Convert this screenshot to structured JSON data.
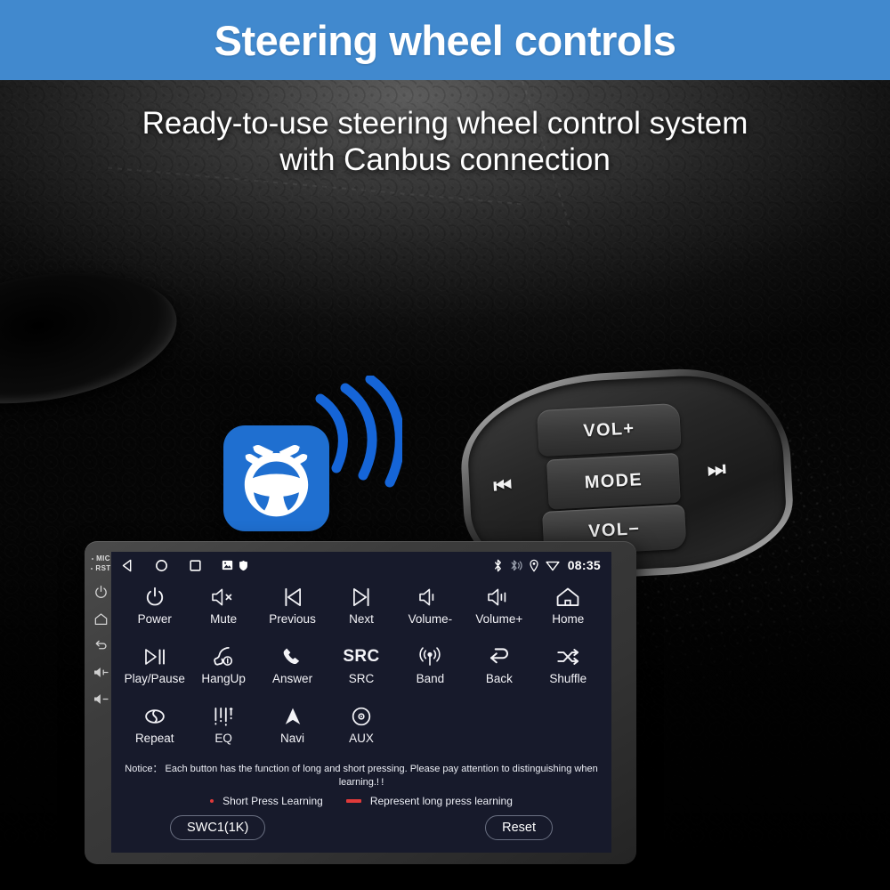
{
  "header": {
    "title": "Steering wheel controls",
    "bg_color": "#4189ce"
  },
  "hero": {
    "subtitle_line1": "Ready-to-use steering wheel control system",
    "subtitle_line2": "with Canbus connection"
  },
  "swc_badge": {
    "icon": "steering-wheel-hands-icon",
    "color": "#1f6fd0",
    "waves_icon": "signal-waves-icon",
    "waves_color": "#1565d8"
  },
  "wheel_pad": {
    "vol_up": "VOL+",
    "mode": "MODE",
    "vol_down": "VOL−",
    "previous_icon": "⏮",
    "next_icon": "⏭"
  },
  "head_unit": {
    "side_rail": {
      "mic_label": "MIC",
      "rst_label": "RST",
      "buttons": [
        {
          "name": "power-icon"
        },
        {
          "name": "home-icon"
        },
        {
          "name": "back-icon"
        },
        {
          "name": "volume-up-icon"
        },
        {
          "name": "volume-down-icon"
        }
      ]
    },
    "status_bar": {
      "nav_icons": [
        "back-triangle-icon",
        "home-circle-icon",
        "recents-square-icon",
        "gallery-icon",
        "shield-icon"
      ],
      "right_icons": [
        "bluetooth-icon",
        "bluetooth-audio-icon",
        "location-pin-icon",
        "wifi-icon"
      ],
      "time": "08:35"
    },
    "functions": [
      {
        "label": "Power",
        "icon": "power-icon"
      },
      {
        "label": "Mute",
        "icon": "speaker-mute-icon"
      },
      {
        "label": "Previous",
        "icon": "skip-previous-icon"
      },
      {
        "label": "Next",
        "icon": "skip-next-icon"
      },
      {
        "label": "Volume-",
        "icon": "volume-down-icon"
      },
      {
        "label": "Volume+",
        "icon": "volume-up-icon"
      },
      {
        "label": "Home",
        "icon": "home-icon"
      },
      {
        "label": "Play/Pause",
        "icon": "play-pause-icon"
      },
      {
        "label": "HangUp",
        "icon": "phone-hangup-icon"
      },
      {
        "label": "Answer",
        "icon": "phone-answer-icon"
      },
      {
        "label": "SRC",
        "icon": "src-text-icon",
        "icon_text": "SRC"
      },
      {
        "label": "Band",
        "icon": "radio-band-icon"
      },
      {
        "label": "Back",
        "icon": "back-arrow-icon"
      },
      {
        "label": "Shuffle",
        "icon": "shuffle-icon"
      },
      {
        "label": "Repeat",
        "icon": "repeat-icon"
      },
      {
        "label": "EQ",
        "icon": "equalizer-icon"
      },
      {
        "label": "Navi",
        "icon": "navigation-arrow-icon"
      },
      {
        "label": "AUX",
        "icon": "aux-disc-icon"
      }
    ],
    "notice": "Notice： Each button has the function of long and short pressing. Please pay attention to distinguishing when learning.! !",
    "legend": {
      "short_press": "Short Press Learning",
      "long_press": "Represent long press learning",
      "marker_color": "#e03a3a"
    },
    "buttons": {
      "swc_label": "SWC1(1K)",
      "reset_label": "Reset"
    }
  }
}
